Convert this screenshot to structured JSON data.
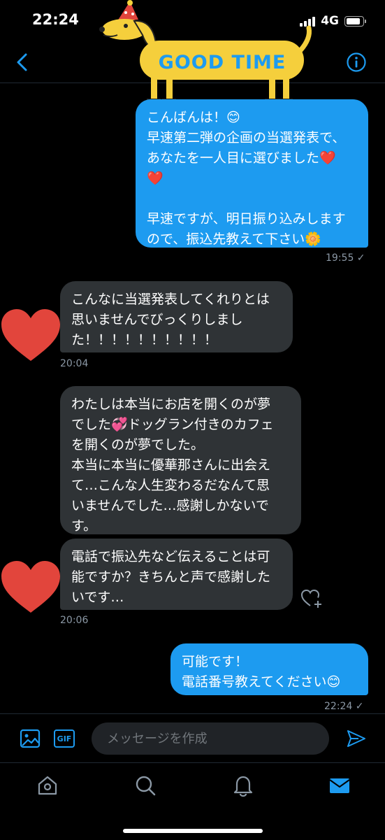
{
  "status": {
    "time": "22:24",
    "network": "4G",
    "battery_level": 0.85
  },
  "header": {
    "sticker_text": "GOOD TIME"
  },
  "messages": [
    {
      "direction": "out",
      "text": "こんばんは！😊\n早速第二弾の企画の当選発表で、\nあなたを一人目に選びました❤️\n❤️\n\n早速ですが、明日振り込みします\nので、振込先教えて下さい🌼",
      "time": "19:55 ✓"
    },
    {
      "direction": "in",
      "text": "こんなに当選発表してくれりとは\n思いませんでびっくりしまし\nた！！！！！！！！！！",
      "time": "20:04"
    },
    {
      "direction": "in",
      "text": "わたしは本当にお店を開くのが夢\nでした💞ドッグラン付きのカフェ\nを開くのが夢でした。\n本当に本当に優華那さんに出会え\nて…こんな人生変わるだなんて思\nいませんでした…感謝しかないで\nす。"
    },
    {
      "direction": "in",
      "text": "電話で振込先など伝えることは可\n能ですか？きちんと声で感謝した\nいです…",
      "time": "20:06"
    },
    {
      "direction": "out",
      "text": "可能です！\n電話番号教えてください😊",
      "time": "22:24 ✓"
    }
  ],
  "compose": {
    "placeholder": "メッセージを作成",
    "gif_label": "GIF"
  },
  "tabs": [
    "home",
    "search",
    "notifications",
    "messages"
  ],
  "colors": {
    "accent": "#1d9bf0",
    "incoming_bubble": "#2f3336",
    "heart": "#e2453c"
  }
}
